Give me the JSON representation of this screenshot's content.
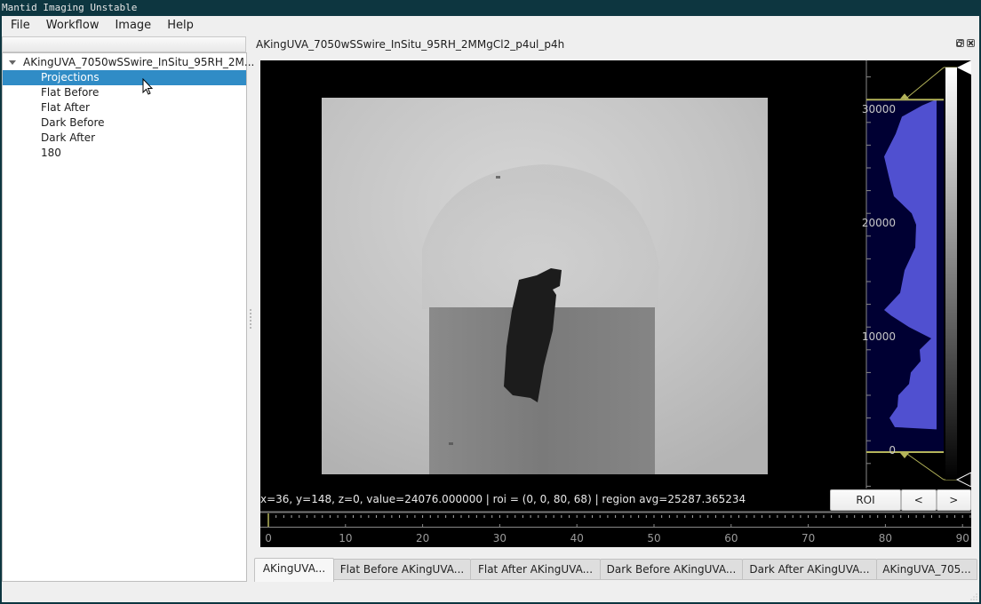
{
  "window": {
    "title": "Mantid Imaging Unstable"
  },
  "menubar": {
    "items": [
      "File",
      "Workflow",
      "Image",
      "Help"
    ]
  },
  "tree": {
    "root_label": "AKingUVA_7050wSSwire_InSitu_95RH_2M...",
    "children": [
      {
        "label": "Projections",
        "selected": true
      },
      {
        "label": "Flat Before",
        "selected": false
      },
      {
        "label": "Flat After",
        "selected": false
      },
      {
        "label": "Dark Before",
        "selected": false
      },
      {
        "label": "Dark After",
        "selected": false
      },
      {
        "label": "180",
        "selected": false
      }
    ]
  },
  "viewer": {
    "title": "AKingUVA_7050wSSwire_InSitu_95RH_2MMgCl2_p4ul_p4h",
    "status_text": "x=36, y=148, z=0, value=24076.000000 | roi = (0, 0, 80, 68) | region avg=25287.365234",
    "buttons": {
      "roi": "ROI",
      "prev": "<",
      "next": ">"
    },
    "histogram": {
      "axis_labels": [
        "30000",
        "20000",
        "10000",
        "0"
      ],
      "axis_values": [
        30000,
        20000,
        10000,
        0
      ],
      "level_min": 0,
      "level_max": 31000,
      "fill_color": "#5050d0",
      "bg_color": "#000033",
      "line_color": "#b4b45a"
    },
    "timeline": {
      "labels": [
        "0",
        "10",
        "20",
        "30",
        "40",
        "50",
        "60",
        "70",
        "80",
        "90"
      ],
      "values": [
        0,
        10,
        20,
        30,
        40,
        50,
        60,
        70,
        80,
        90
      ],
      "current_index": 0,
      "cursor_color": "#b4b45a"
    }
  },
  "tabs": [
    {
      "label": "AKingUVA...",
      "active": true
    },
    {
      "label": "Flat Before AKingUVA...",
      "active": false
    },
    {
      "label": "Flat After AKingUVA...",
      "active": false
    },
    {
      "label": "Dark Before AKingUVA...",
      "active": false
    },
    {
      "label": "Dark After AKingUVA...",
      "active": false
    },
    {
      "label": "AKingUVA_705...",
      "active": false
    }
  ],
  "colors": {
    "selection": "#308cc6",
    "titlebar": "#0d3640"
  }
}
